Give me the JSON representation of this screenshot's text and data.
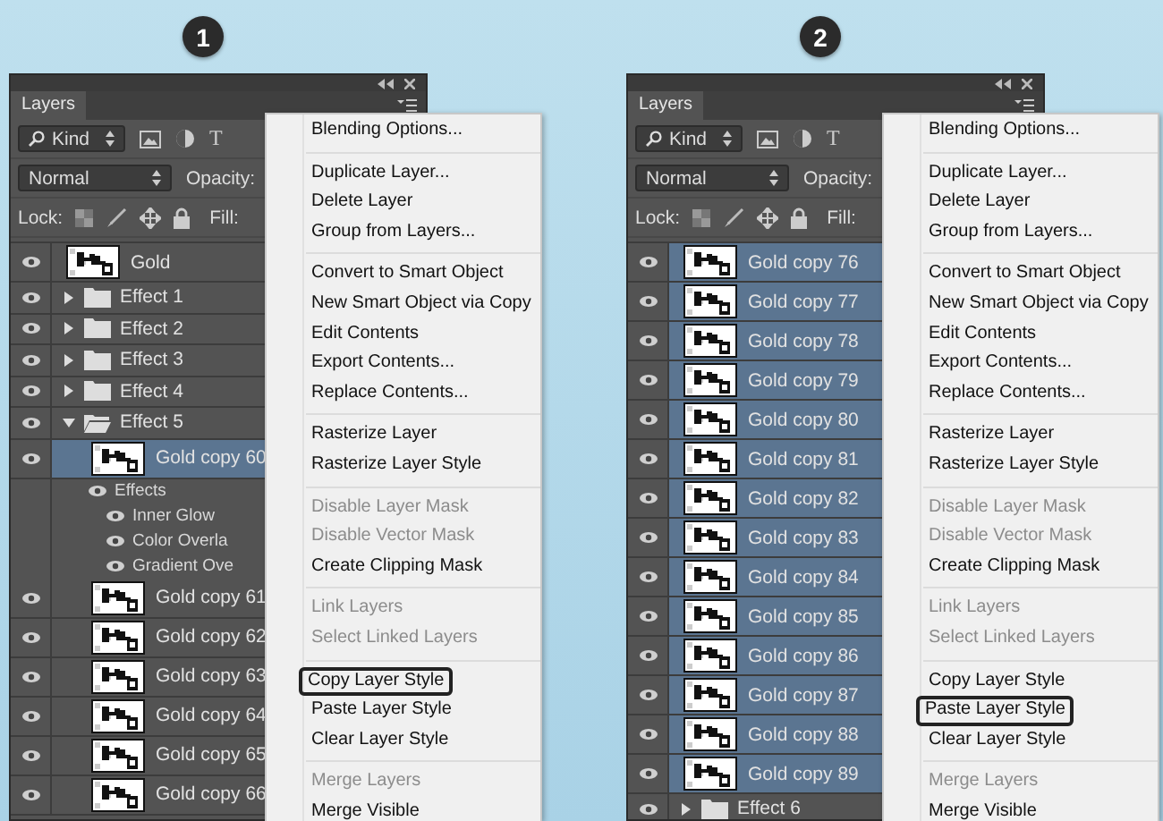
{
  "panels": [
    {
      "step": "1",
      "panel": {
        "tab": "Layers",
        "kind_filter": "Kind",
        "type_filter_glyph": "T",
        "blend_mode": "Normal",
        "opacity_label": "Opacity:",
        "lock_label": "Lock:",
        "fill_label": "Fill:",
        "layers": [
          {
            "kind": "layer",
            "name": "Gold",
            "visible": true,
            "selected": false
          },
          {
            "kind": "group",
            "name": "Effect 1",
            "visible": true,
            "expanded": false,
            "selected": false
          },
          {
            "kind": "group",
            "name": "Effect 2",
            "visible": true,
            "expanded": false,
            "selected": false
          },
          {
            "kind": "group",
            "name": "Effect 3",
            "visible": true,
            "expanded": false,
            "selected": false
          },
          {
            "kind": "group",
            "name": "Effect 4",
            "visible": true,
            "expanded": false,
            "selected": false
          },
          {
            "kind": "group",
            "name": "Effect 5",
            "visible": true,
            "expanded": true,
            "selected": false,
            "children": [
              {
                "kind": "layer",
                "name": "Gold copy 60",
                "visible": true,
                "selected": true,
                "children": [
                  {
                    "kind": "effects",
                    "name": "Effects",
                    "visible": true,
                    "children": [
                      {
                        "kind": "effect",
                        "name": "Inner Glow",
                        "visible": true
                      },
                      {
                        "kind": "effect",
                        "name": "Color Overla",
                        "visible": true
                      },
                      {
                        "kind": "effect",
                        "name": "Gradient Ove",
                        "visible": true
                      }
                    ]
                  }
                ]
              },
              {
                "kind": "layer",
                "name": "Gold copy 61",
                "visible": true,
                "selected": false
              },
              {
                "kind": "layer",
                "name": "Gold copy 62",
                "visible": true,
                "selected": false
              },
              {
                "kind": "layer",
                "name": "Gold copy 63",
                "visible": true,
                "selected": false
              },
              {
                "kind": "layer",
                "name": "Gold copy 64",
                "visible": true,
                "selected": false
              },
              {
                "kind": "layer",
                "name": "Gold copy 65",
                "visible": true,
                "selected": false
              },
              {
                "kind": "layer",
                "name": "Gold copy 66",
                "visible": true,
                "selected": false
              }
            ]
          }
        ]
      },
      "menu": {
        "sections": [
          [
            {
              "label": "Blending Options...",
              "disabled": false,
              "selected": false
            }
          ],
          [
            {
              "label": "Duplicate Layer...",
              "disabled": false,
              "selected": false
            },
            {
              "label": "Delete Layer",
              "disabled": false,
              "selected": false
            },
            {
              "label": "Group from Layers...",
              "disabled": false,
              "selected": false
            }
          ],
          [
            {
              "label": "Convert to Smart Object",
              "disabled": false,
              "selected": false
            },
            {
              "label": "New Smart Object via Copy",
              "disabled": false,
              "selected": false
            },
            {
              "label": "Edit Contents",
              "disabled": false,
              "selected": false
            },
            {
              "label": "Export Contents...",
              "disabled": false,
              "selected": false
            },
            {
              "label": "Replace Contents...",
              "disabled": false,
              "selected": false
            }
          ],
          [
            {
              "label": "Rasterize Layer",
              "disabled": false,
              "selected": false
            },
            {
              "label": "Rasterize Layer Style",
              "disabled": false,
              "selected": false
            }
          ],
          [
            {
              "label": "Disable Layer Mask",
              "disabled": true,
              "selected": false
            },
            {
              "label": "Disable Vector Mask",
              "disabled": true,
              "selected": false
            },
            {
              "label": "Create Clipping Mask",
              "disabled": false,
              "selected": false
            }
          ],
          [
            {
              "label": "Link Layers",
              "disabled": true,
              "selected": false
            },
            {
              "label": "Select Linked Layers",
              "disabled": true,
              "selected": false
            }
          ],
          [
            {
              "label": "Copy Layer Style",
              "disabled": false,
              "selected": true
            },
            {
              "label": "Paste Layer Style",
              "disabled": false,
              "selected": false
            },
            {
              "label": "Clear Layer Style",
              "disabled": false,
              "selected": false
            }
          ],
          [
            {
              "label": "Merge Layers",
              "disabled": true,
              "selected": false
            },
            {
              "label": "Merge Visible",
              "disabled": false,
              "selected": false
            }
          ]
        ]
      }
    },
    {
      "step": "2",
      "panel": {
        "tab": "Layers",
        "kind_filter": "Kind",
        "type_filter_glyph": "T",
        "blend_mode": "Normal",
        "opacity_label": "Opacity:",
        "lock_label": "Lock:",
        "fill_label": "Fill:",
        "layers": [
          {
            "kind": "layer",
            "name": "Gold copy 76",
            "visible": true,
            "selected": true
          },
          {
            "kind": "layer",
            "name": "Gold copy 77",
            "visible": true,
            "selected": true
          },
          {
            "kind": "layer",
            "name": "Gold copy 78",
            "visible": true,
            "selected": true
          },
          {
            "kind": "layer",
            "name": "Gold copy 79",
            "visible": true,
            "selected": true
          },
          {
            "kind": "layer",
            "name": "Gold copy 80",
            "visible": true,
            "selected": true
          },
          {
            "kind": "layer",
            "name": "Gold copy 81",
            "visible": true,
            "selected": true
          },
          {
            "kind": "layer",
            "name": "Gold copy 82",
            "visible": true,
            "selected": true
          },
          {
            "kind": "layer",
            "name": "Gold copy 83",
            "visible": true,
            "selected": true
          },
          {
            "kind": "layer",
            "name": "Gold copy 84",
            "visible": true,
            "selected": true
          },
          {
            "kind": "layer",
            "name": "Gold copy 85",
            "visible": true,
            "selected": true
          },
          {
            "kind": "layer",
            "name": "Gold copy 86",
            "visible": true,
            "selected": true
          },
          {
            "kind": "layer",
            "name": "Gold copy 87",
            "visible": true,
            "selected": true
          },
          {
            "kind": "layer",
            "name": "Gold copy 88",
            "visible": true,
            "selected": true
          },
          {
            "kind": "layer",
            "name": "Gold copy 89",
            "visible": true,
            "selected": true
          },
          {
            "kind": "group",
            "name": "Effect 6",
            "visible": true,
            "expanded": false,
            "selected": false
          }
        ]
      },
      "menu": {
        "sections": [
          [
            {
              "label": "Blending Options...",
              "disabled": false,
              "selected": false
            }
          ],
          [
            {
              "label": "Duplicate Layer...",
              "disabled": false,
              "selected": false
            },
            {
              "label": "Delete Layer",
              "disabled": false,
              "selected": false
            },
            {
              "label": "Group from Layers...",
              "disabled": false,
              "selected": false
            }
          ],
          [
            {
              "label": "Convert to Smart Object",
              "disabled": false,
              "selected": false
            },
            {
              "label": "New Smart Object via Copy",
              "disabled": false,
              "selected": false
            },
            {
              "label": "Edit Contents",
              "disabled": false,
              "selected": false
            },
            {
              "label": "Export Contents...",
              "disabled": false,
              "selected": false
            },
            {
              "label": "Replace Contents...",
              "disabled": false,
              "selected": false
            }
          ],
          [
            {
              "label": "Rasterize Layer",
              "disabled": false,
              "selected": false
            },
            {
              "label": "Rasterize Layer Style",
              "disabled": false,
              "selected": false
            }
          ],
          [
            {
              "label": "Disable Layer Mask",
              "disabled": true,
              "selected": false
            },
            {
              "label": "Disable Vector Mask",
              "disabled": true,
              "selected": false
            },
            {
              "label": "Create Clipping Mask",
              "disabled": false,
              "selected": false
            }
          ],
          [
            {
              "label": "Link Layers",
              "disabled": true,
              "selected": false
            },
            {
              "label": "Select Linked Layers",
              "disabled": true,
              "selected": false
            }
          ],
          [
            {
              "label": "Copy Layer Style",
              "disabled": false,
              "selected": false
            },
            {
              "label": "Paste Layer Style",
              "disabled": false,
              "selected": true
            },
            {
              "label": "Clear Layer Style",
              "disabled": false,
              "selected": false
            }
          ],
          [
            {
              "label": "Merge Layers",
              "disabled": true,
              "selected": false
            },
            {
              "label": "Merge Visible",
              "disabled": false,
              "selected": false
            }
          ]
        ]
      }
    }
  ]
}
